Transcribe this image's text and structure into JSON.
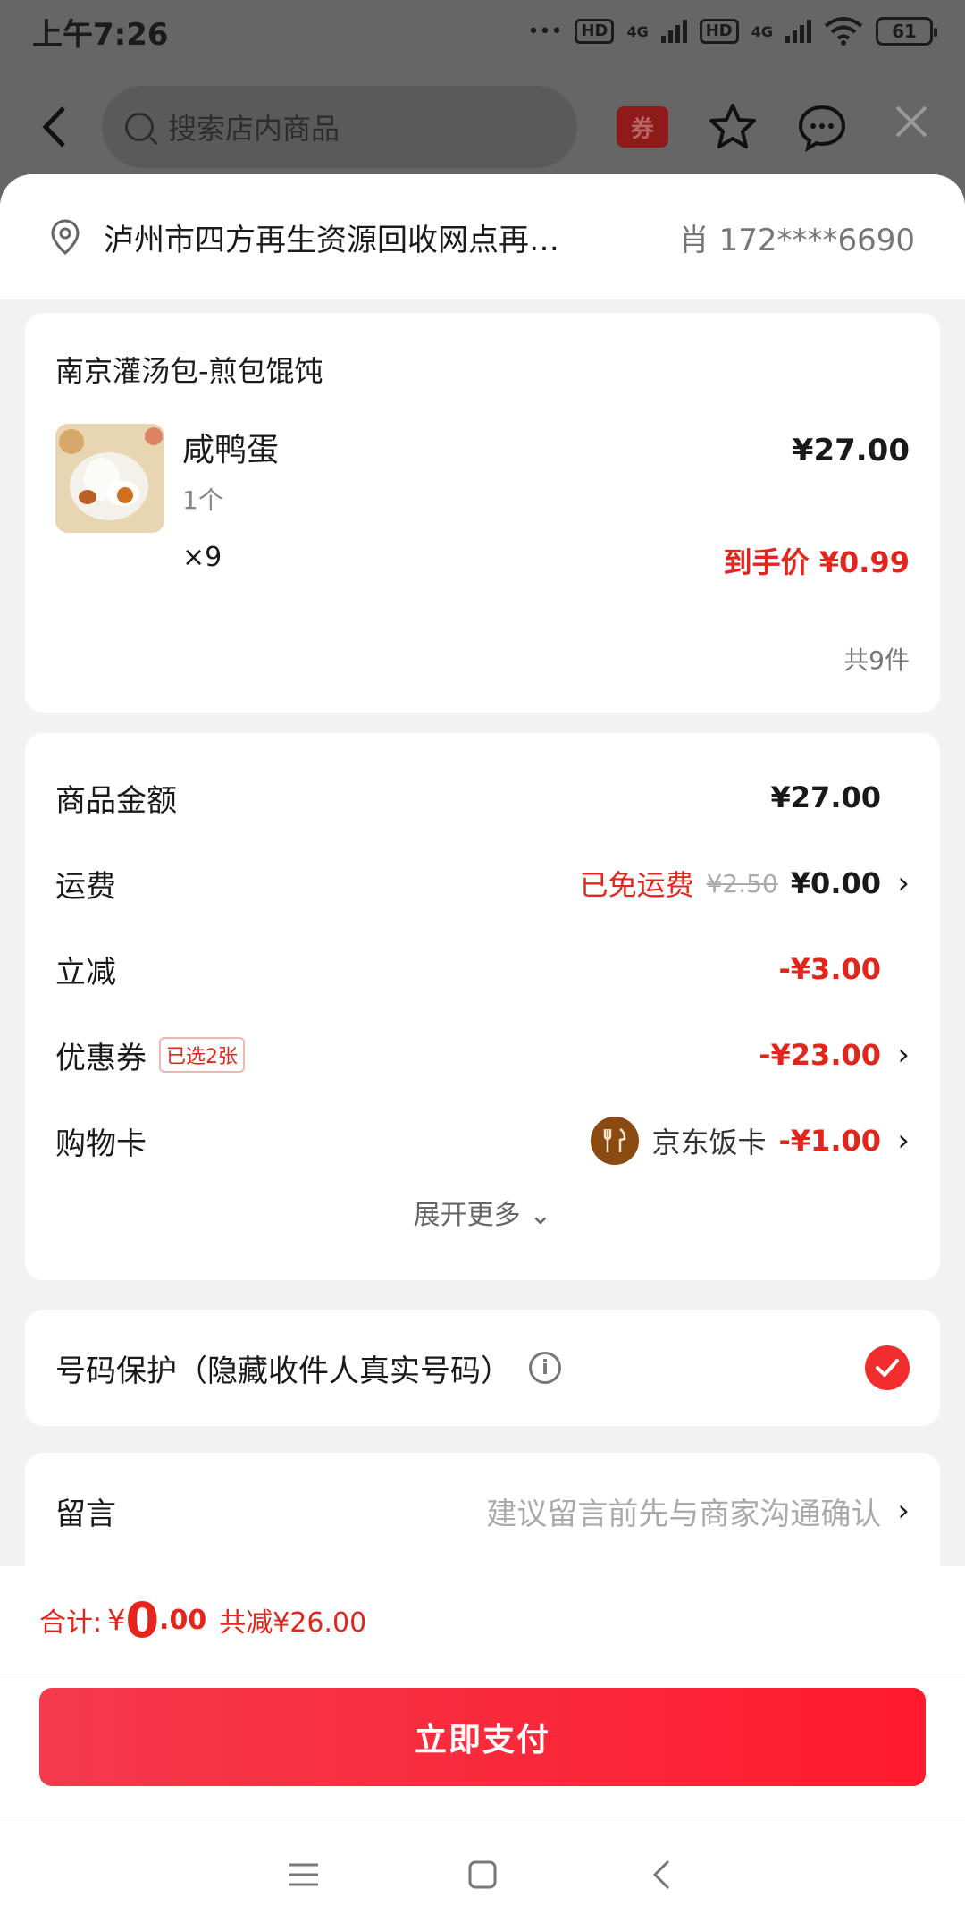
{
  "status_bar": {
    "time": "上午7:26",
    "hd1": "HD",
    "net1": "4G",
    "hd2": "HD",
    "net2": "4G",
    "battery": "61",
    "dots": "•••"
  },
  "top_nav": {
    "search_placeholder": "搜索店内商品",
    "coupon_label": "券"
  },
  "address": {
    "text": "泸州市四方再生资源回收网点再…",
    "recipient": "肖  172****6690"
  },
  "shop": {
    "name": "南京灌汤包-煎包馄饨",
    "item": {
      "title": "咸鸭蛋",
      "spec": "1个",
      "quantity": "×9",
      "price": "¥27.00",
      "final_price": "到手价 ¥0.99"
    },
    "total_count": "共9件"
  },
  "fees": {
    "goods_label": "商品金额",
    "goods_value": "¥27.00",
    "shipping_label": "运费",
    "shipping_free": "已免运费",
    "shipping_original": "¥2.50",
    "shipping_value": "¥0.00",
    "discount_label": "立减",
    "discount_value": "-¥3.00",
    "coupon_label": "优惠券",
    "coupon_tag": "已选2张",
    "coupon_value": "-¥23.00",
    "giftcard_label": "购物卡",
    "giftcard_name": "京东饭卡",
    "giftcard_value": "-¥1.00",
    "expand": "展开更多 ⌄"
  },
  "privacy": {
    "label": "号码保护（隐藏收件人真实号码）",
    "info_glyph": "i",
    "checked": true
  },
  "message": {
    "label": "留言",
    "placeholder": "建议留言前先与商家沟通确认"
  },
  "total": {
    "label": "合计:",
    "currency": "¥",
    "integer": "0",
    "decimal": ".00",
    "saved": "共减¥26.00"
  },
  "pay_button": "立即支付",
  "colors": {
    "accent_red": "#e3251d",
    "pay_gradient_start": "#f43a4c",
    "pay_gradient_end": "#ff1a2d"
  }
}
